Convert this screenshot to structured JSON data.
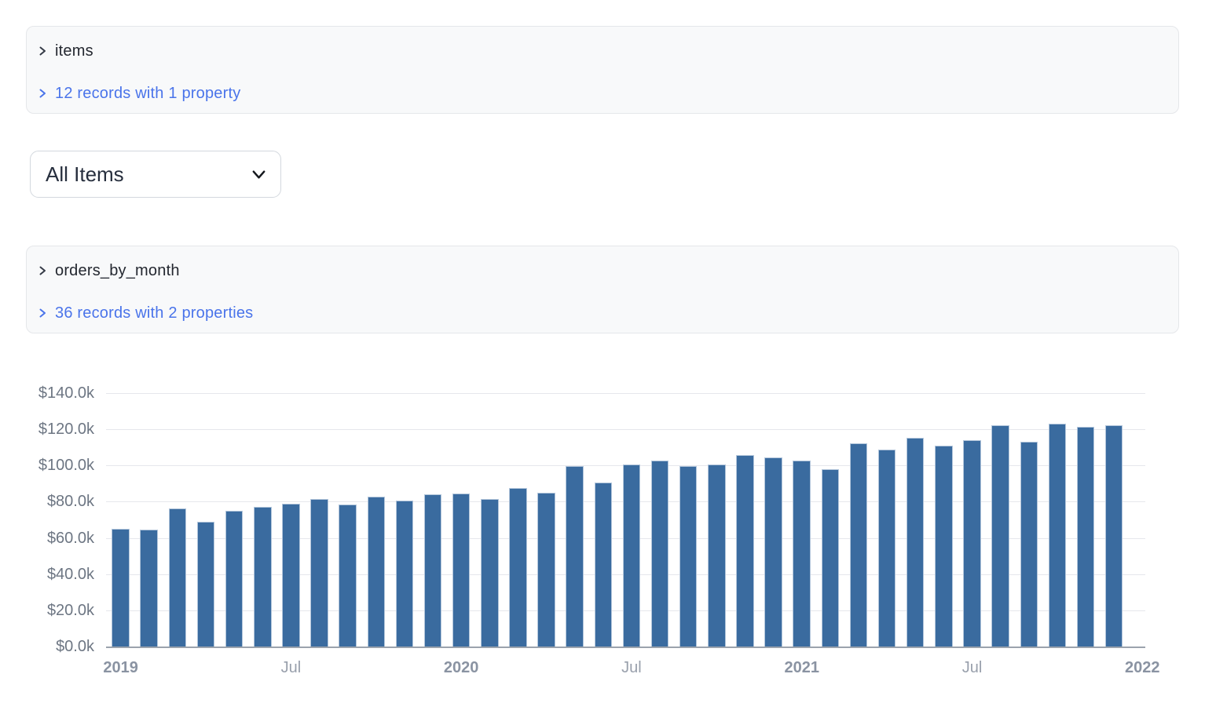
{
  "colors": {
    "link": "#4a74ea",
    "bar": "#3a6b9f"
  },
  "panels": [
    {
      "title": "items",
      "summary": "12 records with 1 property"
    },
    {
      "title": "orders_by_month",
      "summary": "36 records with 2 properties"
    }
  ],
  "filter": {
    "selected": "All Items"
  },
  "chart_data": {
    "type": "bar",
    "title": "",
    "xlabel": "",
    "ylabel": "",
    "ylim": [
      0,
      140000
    ],
    "grid": true,
    "categories": [
      "2019-01",
      "2019-02",
      "2019-03",
      "2019-04",
      "2019-05",
      "2019-06",
      "2019-07",
      "2019-08",
      "2019-09",
      "2019-10",
      "2019-11",
      "2019-12",
      "2020-01",
      "2020-02",
      "2020-03",
      "2020-04",
      "2020-05",
      "2020-06",
      "2020-07",
      "2020-08",
      "2020-09",
      "2020-10",
      "2020-11",
      "2020-12",
      "2021-01",
      "2021-02",
      "2021-03",
      "2021-04",
      "2021-05",
      "2021-06",
      "2021-07",
      "2021-08",
      "2021-09",
      "2021-10",
      "2021-11",
      "2021-12"
    ],
    "values": [
      65000,
      64500,
      76100,
      69000,
      75000,
      77000,
      79000,
      81400,
      78300,
      82900,
      80700,
      84300,
      84600,
      81700,
      87700,
      85100,
      99600,
      90400,
      100600,
      102900,
      99500,
      100600,
      105600,
      104300,
      102700,
      98100,
      112200,
      108700,
      115300,
      111000,
      114200,
      122200,
      113300,
      123000,
      121200,
      122300
    ],
    "y_axis": {
      "ticks": [
        {
          "v": 0,
          "label": "$0.0k"
        },
        {
          "v": 20000,
          "label": "$20.0k"
        },
        {
          "v": 40000,
          "label": "$40.0k"
        },
        {
          "v": 60000,
          "label": "$60.0k"
        },
        {
          "v": 80000,
          "label": "$80.0k"
        },
        {
          "v": 100000,
          "label": "$100.0k"
        },
        {
          "v": 120000,
          "label": "$120.0k"
        },
        {
          "v": 140000,
          "label": "$140.0k"
        }
      ]
    },
    "x_axis": {
      "ticks": [
        {
          "label": "2019",
          "band": 0,
          "bold": true
        },
        {
          "label": "Jul",
          "band": 6,
          "bold": false
        },
        {
          "label": "2020",
          "band": 12,
          "bold": true
        },
        {
          "label": "Jul",
          "band": 18,
          "bold": false
        },
        {
          "label": "2021",
          "band": 24,
          "bold": true
        },
        {
          "label": "Jul",
          "band": 30,
          "bold": false
        },
        {
          "label": "2022",
          "band": 36,
          "bold": true
        }
      ]
    }
  }
}
